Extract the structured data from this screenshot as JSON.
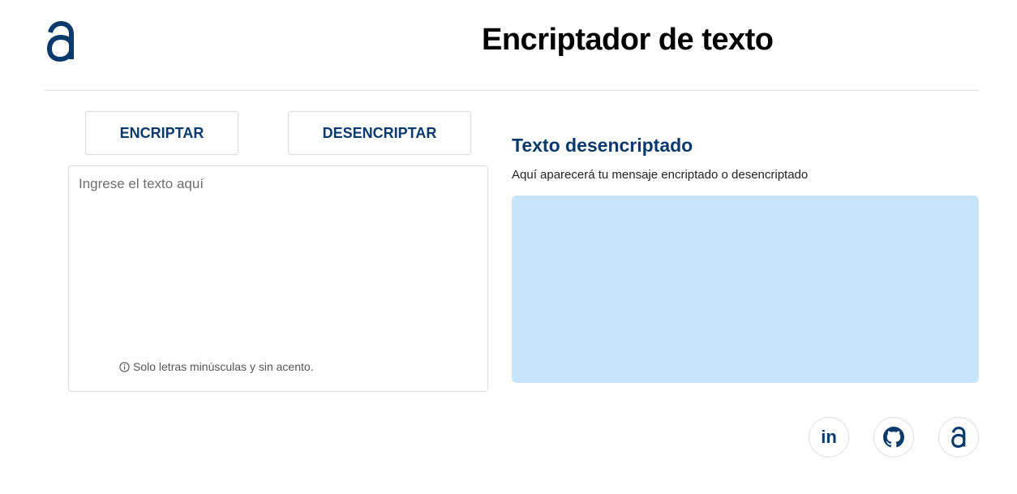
{
  "header": {
    "title": "Encriptador de texto",
    "logo_icon": "alura-logo-icon"
  },
  "actions": {
    "encrypt_label": "ENCRIPTAR",
    "decrypt_label": "DESENCRIPTAR"
  },
  "input": {
    "placeholder": "Ingrese el texto aquí",
    "value": "",
    "hint": "Solo letras minúsculas y sin acento.",
    "hint_icon": "info-icon"
  },
  "output": {
    "title": "Texto desencriptado",
    "subtitle": "Aquí aparecerá tu mensaje encriptado o desencriptado",
    "value": ""
  },
  "social": {
    "linkedin_label": "in",
    "icons": [
      "linkedin-icon",
      "github-icon",
      "alura-icon"
    ]
  },
  "colors": {
    "brand": "#0a3a6b",
    "output_bg": "#c8e4f8",
    "border": "#dcdcdc"
  }
}
